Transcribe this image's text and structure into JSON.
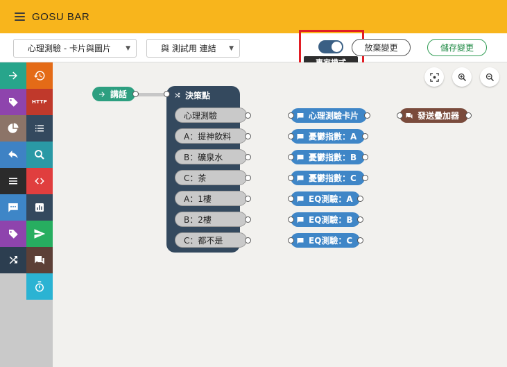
{
  "header": {
    "title": "GOSU BAR"
  },
  "toolbar": {
    "dropdown1": "心理測驗 - 卡片與圖片",
    "dropdown2": "與 測試用 連結",
    "expert_tooltip": "專家模式",
    "discard": "放棄變更",
    "save": "儲存變更"
  },
  "sidebar": {
    "http_label": "HTTP"
  },
  "flow": {
    "start_node": "講話",
    "decision_node": "決策點",
    "options": [
      "心理測驗",
      "A：提神飲料",
      "B：礦泉水",
      "C：茶",
      "A：1樓",
      "B：2樓",
      "C：都不是"
    ],
    "cards": [
      "心理測驗卡片",
      "憂鬱指數：A",
      "憂鬱指數：B",
      "憂鬱指數：C",
      "EQ測驗：A",
      "EQ測驗：B",
      "EQ測驗：C"
    ],
    "counter_node": "發送疊加器"
  },
  "colors": {
    "header": "#f8b51c",
    "accent_toggle": "#3a5f84",
    "save_green": "#2e9b52",
    "highlight_red": "#e11d24"
  }
}
